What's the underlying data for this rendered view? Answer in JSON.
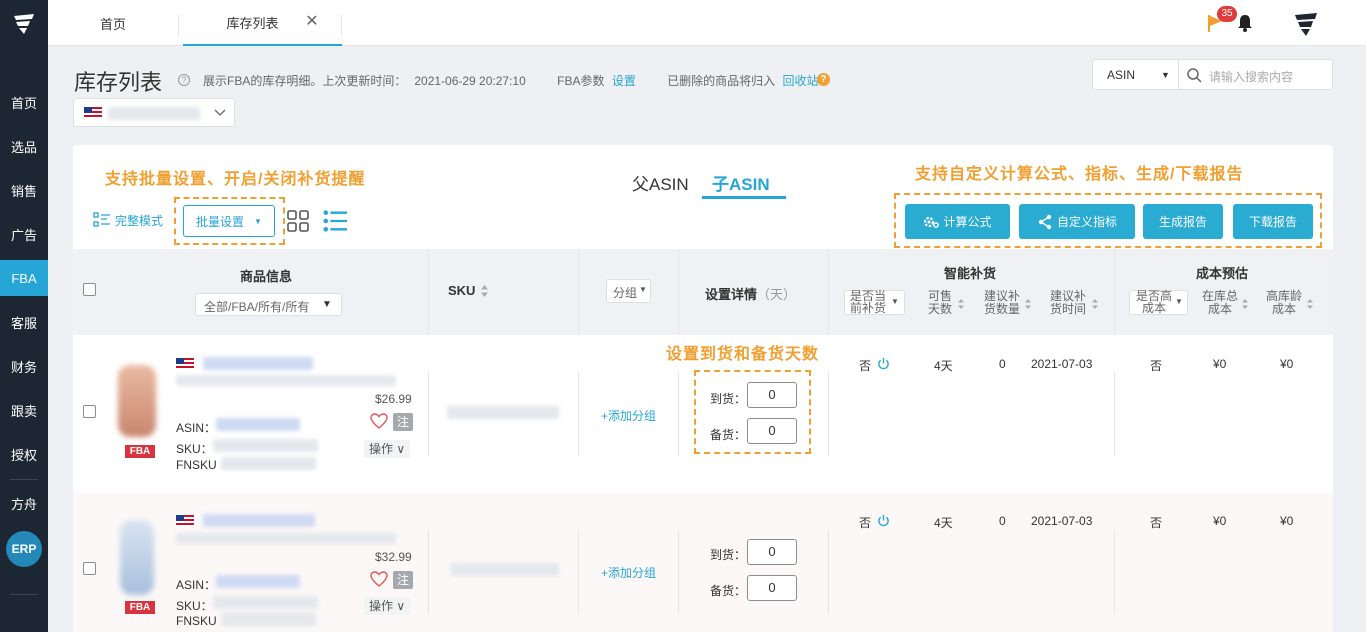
{
  "sidebar": {
    "items": [
      {
        "label": "首页"
      },
      {
        "label": "选品"
      },
      {
        "label": "销售"
      },
      {
        "label": "广告"
      },
      {
        "label": "FBA"
      },
      {
        "label": "客服"
      },
      {
        "label": "财务"
      },
      {
        "label": "跟卖"
      },
      {
        "label": "授权"
      },
      {
        "label": "方舟"
      }
    ],
    "erp": "ERP"
  },
  "topbar": {
    "tabs": [
      {
        "label": "首页"
      },
      {
        "label": "库存列表"
      }
    ],
    "close": "✕",
    "badge": "35"
  },
  "page": {
    "title": "库存列表",
    "desc1": "展示FBA的库存明细。上次更新时间：",
    "update_time": "2021-06-29 20:27:10",
    "fba_param": "FBA参数",
    "fba_param_link": "设置",
    "deleted_note": "已删除的商品将归入",
    "recycle": "回收站"
  },
  "search": {
    "type": "ASIN",
    "placeholder": "请输入搜索内容"
  },
  "annotations": {
    "batch": "支持批量设置、开启/关闭补货提醒",
    "report": "支持自定义计算公式、指标、生成/下载报告",
    "days": "设置到货和备货天数"
  },
  "toolbar": {
    "mode": "完整模式",
    "batch": "批量设置",
    "parent_asin": "父ASIN",
    "child_asin": "子ASIN",
    "buttons": [
      "计算公式",
      "自定义指标",
      "生成报告",
      "下载报告"
    ]
  },
  "table": {
    "h_product": "商品信息",
    "h_product_filter": "全部/FBA/所有/所有",
    "h_sku": "SKU",
    "h_group": "分组",
    "h_setting": "设置详情",
    "h_setting_unit": "（天）",
    "h_smart": "智能补货",
    "h_cost": "成本预估",
    "sub_smart": [
      "是否当前补货",
      "可售天数",
      "建议补货数量",
      "建议补货时间"
    ],
    "sub_cost": [
      "是否高成本",
      "在库总成本",
      "高库龄成本"
    ]
  },
  "rows": [
    {
      "price": "$26.99",
      "asin": "ASIN：",
      "sku": "SKU：",
      "fnsku": "FNSKU",
      "fba": "FBA",
      "note": "注",
      "op": "操作 ∨",
      "add_group": "+添加分组",
      "arrive_label": "到货：",
      "arrive": "0",
      "stock_label": "备货：",
      "stock": "0",
      "replenish": "否",
      "days": "4天",
      "qty": "0",
      "date": "2021-07-03",
      "high_cost": "否",
      "stock_cost": "¥0",
      "aged_cost": "¥0"
    },
    {
      "price": "$32.99",
      "asin": "ASIN：",
      "sku": "SKU：",
      "fnsku": "FNSKU",
      "fba": "FBA",
      "note": "注",
      "op": "操作 ∨",
      "add_group": "+添加分组",
      "arrive_label": "到货：",
      "arrive": "0",
      "stock_label": "备货：",
      "stock": "0",
      "replenish": "否",
      "days": "4天",
      "qty": "0",
      "date": "2021-07-03",
      "high_cost": "否",
      "stock_cost": "¥0",
      "aged_cost": "¥0"
    }
  ],
  "colors": {
    "accent": "#26a6d6",
    "sidebar": "#1c2733",
    "annotation": "#f0a030",
    "fba": "#d9333f"
  }
}
